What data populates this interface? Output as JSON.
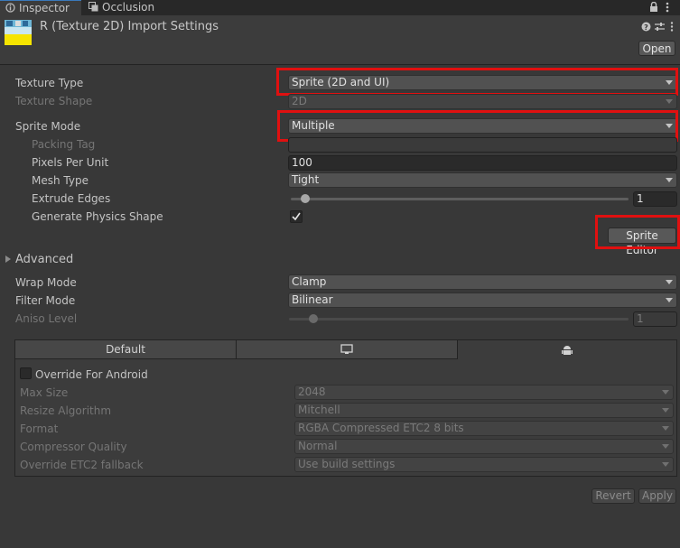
{
  "tabs": [
    {
      "label": "Inspector",
      "icon": "inspector-icon"
    },
    {
      "label": "Occlusion",
      "icon": "occlusion-icon"
    }
  ],
  "header": {
    "title": "R (Texture 2D) Import Settings",
    "open_label": "Open",
    "icons": [
      "texture-icon",
      "help-icon",
      "preset-icon",
      "menu-icon"
    ]
  },
  "fields": {
    "texture_type": {
      "label": "Texture Type",
      "value": "Sprite (2D and UI)"
    },
    "texture_shape": {
      "label": "Texture Shape",
      "value": "2D"
    },
    "sprite_mode": {
      "label": "Sprite Mode",
      "value": "Multiple"
    },
    "packing_tag": {
      "label": "Packing Tag",
      "value": ""
    },
    "pixels_per_unit": {
      "label": "Pixels Per Unit",
      "value": "100"
    },
    "mesh_type": {
      "label": "Mesh Type",
      "value": "Tight"
    },
    "extrude_edges": {
      "label": "Extrude Edges",
      "value": "1"
    },
    "generate_physics": {
      "label": "Generate Physics Shape",
      "checked": true
    },
    "sprite_editor_label": "Sprite Editor",
    "advanced_label": "Advanced",
    "wrap_mode": {
      "label": "Wrap Mode",
      "value": "Clamp"
    },
    "filter_mode": {
      "label": "Filter Mode",
      "value": "Bilinear"
    },
    "aniso_level": {
      "label": "Aniso Level",
      "value": "1"
    }
  },
  "platform": {
    "tabs": [
      {
        "label": "Default"
      },
      {
        "icon": "monitor-icon"
      },
      {
        "icon": "android-icon"
      }
    ],
    "override_label": "Override For Android",
    "override_checked": false,
    "rows": [
      {
        "label": "Max Size",
        "value": "2048"
      },
      {
        "label": "Resize Algorithm",
        "value": "Mitchell"
      },
      {
        "label": "Format",
        "value": "RGBA Compressed ETC2 8 bits"
      },
      {
        "label": "Compressor Quality",
        "value": "Normal"
      },
      {
        "label": "Override ETC2 fallback",
        "value": "Use build settings"
      }
    ]
  },
  "actions": {
    "revert": "Revert",
    "apply": "Apply"
  },
  "colors": {
    "highlight": "#e01010",
    "background": "#383838",
    "accent": "#3a79bb"
  }
}
